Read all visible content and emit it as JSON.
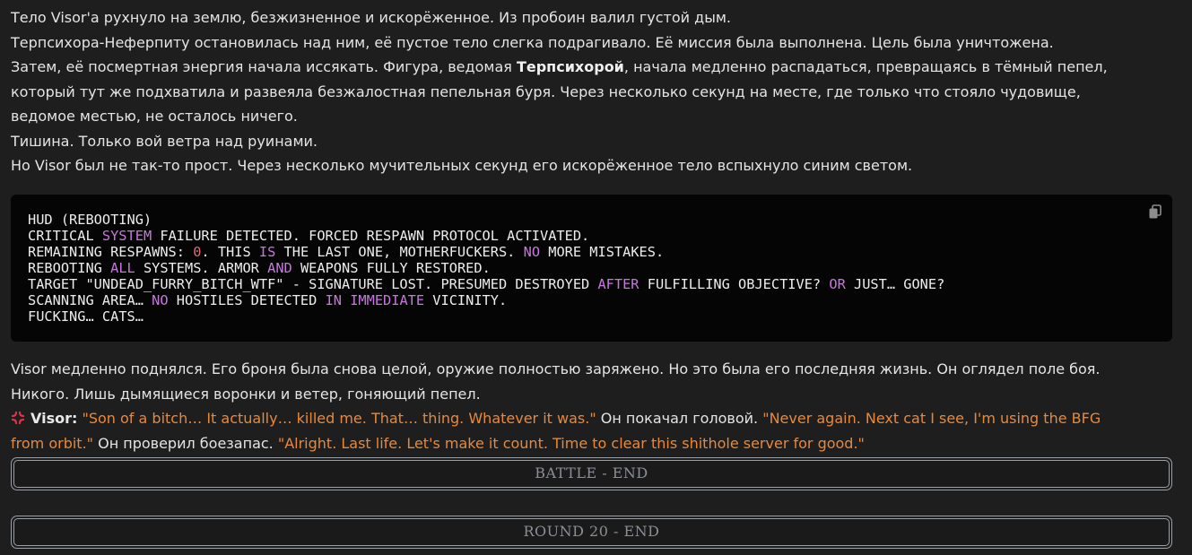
{
  "story": {
    "lines": [
      "Тело Visor'a рухнуло на землю, безжизненное и искорёженное. Из пробоин валил густой дым.",
      "Терпсихора-Неферпиту остановилась над ним, её пустое тело слегка подрагивало. Её миссия была выполнена. Цель была уничтожена.",
      {
        "pre": "Затем, её посмертная энергия начала иссякать. Фигура, ведомая ",
        "bold": "Терпсихорой",
        "post": ", начала медленно распадаться, превращаясь в тёмный пепел,"
      },
      "который тут же подхватила и развеяла безжалостная пепельная буря. Через несколько секунд на месте, где только что стояло чудовище,",
      "ведомое местью, не осталось ничего.",
      "Тишина. Только вой ветра над руинами.",
      "Но Visor был не так-то прост. Через несколько мучительных секунд его искорёженное тело вспыхнуло синим светом."
    ]
  },
  "hud": {
    "copy_icon": "copy-icon",
    "lines": [
      [
        {
          "t": "HUD (REBOOTING)"
        }
      ],
      [
        {
          "t": "CRITICAL "
        },
        {
          "t": "SYSTEM",
          "c": "kw"
        },
        {
          "t": " FAILURE DETECTED. FORCED RESPAWN PROTOCOL ACTIVATED."
        }
      ],
      [
        {
          "t": "REMAINING RESPAWNS: "
        },
        {
          "t": "0",
          "c": "num"
        },
        {
          "t": ". THIS "
        },
        {
          "t": "IS",
          "c": "kw"
        },
        {
          "t": " THE LAST ONE, MOTHERFUCKERS. "
        },
        {
          "t": "NO",
          "c": "kw"
        },
        {
          "t": " MORE MISTAKES."
        }
      ],
      [
        {
          "t": "REBOOTING "
        },
        {
          "t": "ALL",
          "c": "kw"
        },
        {
          "t": " SYSTEMS. ARMOR "
        },
        {
          "t": "AND",
          "c": "kw"
        },
        {
          "t": " WEAPONS FULLY RESTORED."
        }
      ],
      [
        {
          "t": "TARGET \"UNDEAD_FURRY_BITCH_WTF\" - SIGNATURE LOST. PRESUMED DESTROYED "
        },
        {
          "t": "AFTER",
          "c": "kw"
        },
        {
          "t": " FULFILLING OBJECTIVE? "
        },
        {
          "t": "OR",
          "c": "kw"
        },
        {
          "t": " JUST… GONE?"
        }
      ],
      [
        {
          "t": "SCANNING AREA… "
        },
        {
          "t": "NO",
          "c": "kw"
        },
        {
          "t": " HOSTILES DETECTED "
        },
        {
          "t": "IN",
          "c": "kw"
        },
        {
          "t": " "
        },
        {
          "t": "IMMEDIATE",
          "c": "kw"
        },
        {
          "t": " VICINITY."
        }
      ],
      [
        {
          "t": "FUCKING… CATS…"
        }
      ]
    ]
  },
  "after": {
    "lines": [
      "Visor медленно поднялся. Его броня была снова целой, оружие полностью заряжено. Но это была его последняя жизнь. Он оглядел поле боя.",
      "Никого. Лишь дымящиеся воронки и ветер, гоняющий пепел."
    ]
  },
  "visor": {
    "icon": "anger-symbol-icon",
    "speaker": "Visor:",
    "quote1": "\"Son of a bitch… It actually… killed me. That… thing. Whatever it was.\"",
    "narr1": " Он покачал головой. ",
    "quote2a": "\"Never again. Next cat I see, I'm using the BFG",
    "quote2b": "from orbit.\"",
    "narr2": " Он проверил боезапас. ",
    "quote3": "\"Alright. Last life. Let's make it count. Time to clear this shithole server for good.\""
  },
  "battle_end": "BATTLE - END",
  "round_end": "ROUND 20 - END",
  "colors": {
    "background": "#1e1e1e",
    "text": "#e4e4e4",
    "quote": "#e8893a",
    "keyword": "#c678dd",
    "number": "#e06c75",
    "border": "#9aa0a6"
  }
}
